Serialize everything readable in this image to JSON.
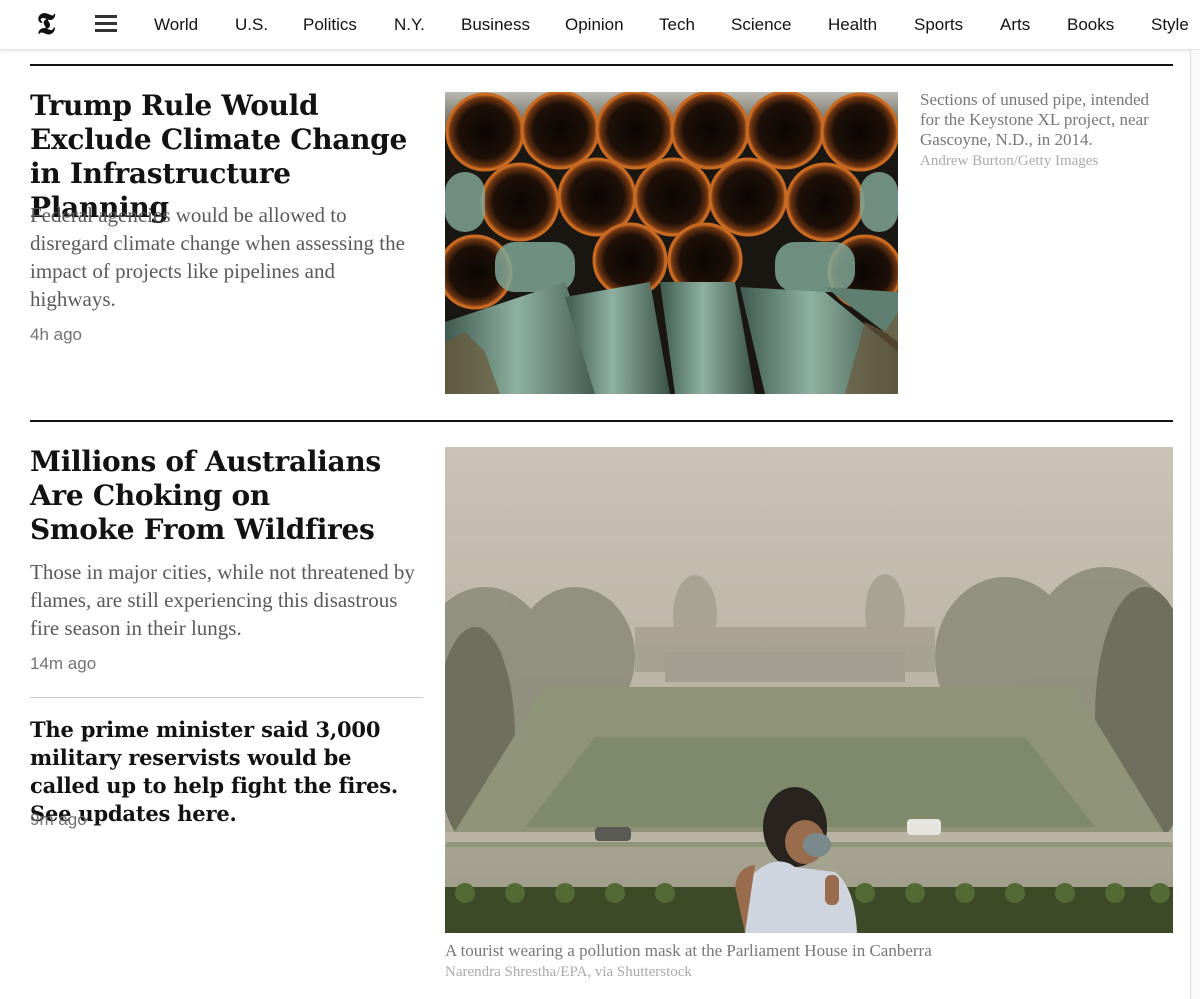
{
  "nav": {
    "logo": "𝕿",
    "links": [
      "World",
      "U.S.",
      "Politics",
      "N.Y.",
      "Business",
      "Opinion",
      "Tech",
      "Science",
      "Health",
      "Sports",
      "Arts",
      "Books",
      "Style"
    ]
  },
  "story1": {
    "headline_lines": [
      "Trump Rule Would",
      "Exclude Climate Change",
      "in Infrastructure Planning"
    ],
    "summary": "Federal agencies would be allowed to disregard climate change when assessing the impact of projects like pipelines and highways.",
    "timestamp": "4h ago",
    "caption": "Sections of unused pipe, intended for the Keystone XL project, near Gascoyne, N.D., in 2014.",
    "credit": "Andrew Burton/Getty Images"
  },
  "story2": {
    "headline_lines": [
      "Millions of Australians",
      "Are Choking on",
      "Smoke From Wildfires"
    ],
    "summary": "Those in major cities, while not threatened by flames, are still experiencing this disastrous fire season in their lungs.",
    "timestamp": "14m ago",
    "sub_headline": "The prime minister said 3,000 military reservists would be called up to help fight the fires. See updates here.",
    "sub_timestamp": "9m ago",
    "caption": "A tourist wearing a pollution mask at the Parliament House in Canberra",
    "credit": "Narendra Shrestha/EPA, via Shutterstock"
  }
}
